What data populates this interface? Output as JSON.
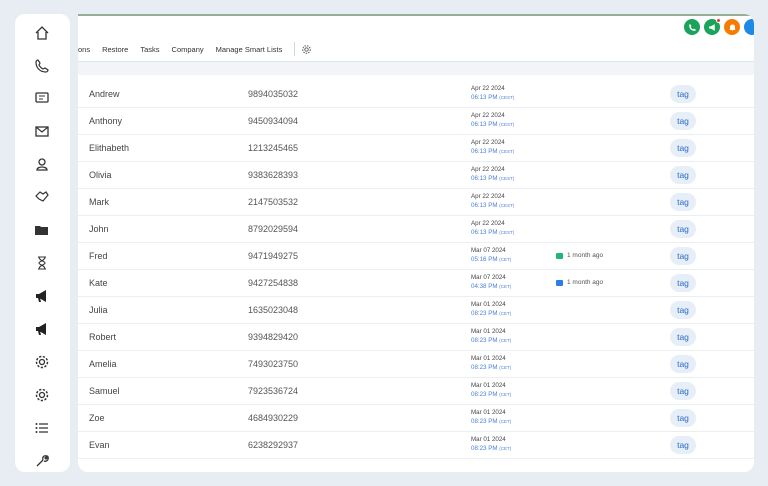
{
  "toolbar": {
    "items": [
      "ons",
      "Restore",
      "Tasks",
      "Company",
      "Manage Smart Lists"
    ]
  },
  "header_icons": [
    {
      "name": "phone-icon",
      "color": "#1aa35b"
    },
    {
      "name": "megaphone-icon",
      "color": "#1aa35b",
      "badge": true
    },
    {
      "name": "bell-icon",
      "color": "#f57c00"
    },
    {
      "name": "profile-icon",
      "color": "#1e88e5"
    }
  ],
  "sidebar_icons": [
    "home-icon",
    "phone-icon",
    "chat-icon",
    "mail-icon",
    "user-icon",
    "handshake-icon",
    "folder-icon",
    "hourglass-icon",
    "megaphone-icon",
    "megaphone-icon",
    "gear-icon",
    "gear-icon",
    "list-icon",
    "wrench-icon"
  ],
  "contacts": [
    {
      "name": "Andrew",
      "phone": "9894035032",
      "date": "Apr 22 2024",
      "time": "06:13 PM",
      "tz": "(CEST)",
      "activity": "",
      "tag": "tag"
    },
    {
      "name": "Anthony",
      "phone": "9450934094",
      "date": "Apr 22 2024",
      "time": "06:13 PM",
      "tz": "(CEST)",
      "activity": "",
      "tag": "tag"
    },
    {
      "name": "Elithabeth",
      "phone": "1213245465",
      "date": "Apr 22 2024",
      "time": "06:13 PM",
      "tz": "(CEST)",
      "activity": "",
      "tag": "tag"
    },
    {
      "name": "Olivia",
      "phone": "9383628393",
      "date": "Apr 22 2024",
      "time": "06:13 PM",
      "tz": "(CEST)",
      "activity": "",
      "tag": "tag"
    },
    {
      "name": "Mark",
      "phone": "2147503532",
      "date": "Apr 22 2024",
      "time": "06:13 PM",
      "tz": "(CEST)",
      "activity": "",
      "tag": "tag"
    },
    {
      "name": "John",
      "phone": "8792029594",
      "date": "Apr 22 2024",
      "time": "06:13 PM",
      "tz": "(CEST)",
      "activity": "",
      "tag": "tag"
    },
    {
      "name": "Fred",
      "phone": "9471949275",
      "date": "Mar 07 2024",
      "time": "05:16 PM",
      "tz": "(CET)",
      "activity": "1 month ago",
      "activity_icon": "chat-icon",
      "activity_color": "#22b573",
      "tag": "tag"
    },
    {
      "name": "Kate",
      "phone": "9427254838",
      "date": "Mar 07 2024",
      "time": "04:38 PM",
      "tz": "(CET)",
      "activity": "1 month ago",
      "activity_icon": "mail-icon",
      "activity_color": "#2b7de9",
      "tag": "tag"
    },
    {
      "name": "Julia",
      "phone": "1635023048",
      "date": "Mar 01 2024",
      "time": "08:23 PM",
      "tz": "(CET)",
      "activity": "",
      "tag": "tag"
    },
    {
      "name": "Robert",
      "phone": "9394829420",
      "date": "Mar 01 2024",
      "time": "08:23 PM",
      "tz": "(CET)",
      "activity": "",
      "tag": "tag"
    },
    {
      "name": "Amelia",
      "phone": "7493023750",
      "date": "Mar 01 2024",
      "time": "08:23 PM",
      "tz": "(CET)",
      "activity": "",
      "tag": "tag"
    },
    {
      "name": "Samuel",
      "phone": "7923536724",
      "date": "Mar 01 2024",
      "time": "08:23 PM",
      "tz": "(CET)",
      "activity": "",
      "tag": "tag"
    },
    {
      "name": "Zoe",
      "phone": "4684930229",
      "date": "Mar 01 2024",
      "time": "08:23 PM",
      "tz": "(CET)",
      "activity": "",
      "tag": "tag"
    },
    {
      "name": "Evan",
      "phone": "6238292937",
      "date": "Mar 01 2024",
      "time": "08:23 PM",
      "tz": "(CET)",
      "activity": "",
      "tag": "tag"
    }
  ]
}
